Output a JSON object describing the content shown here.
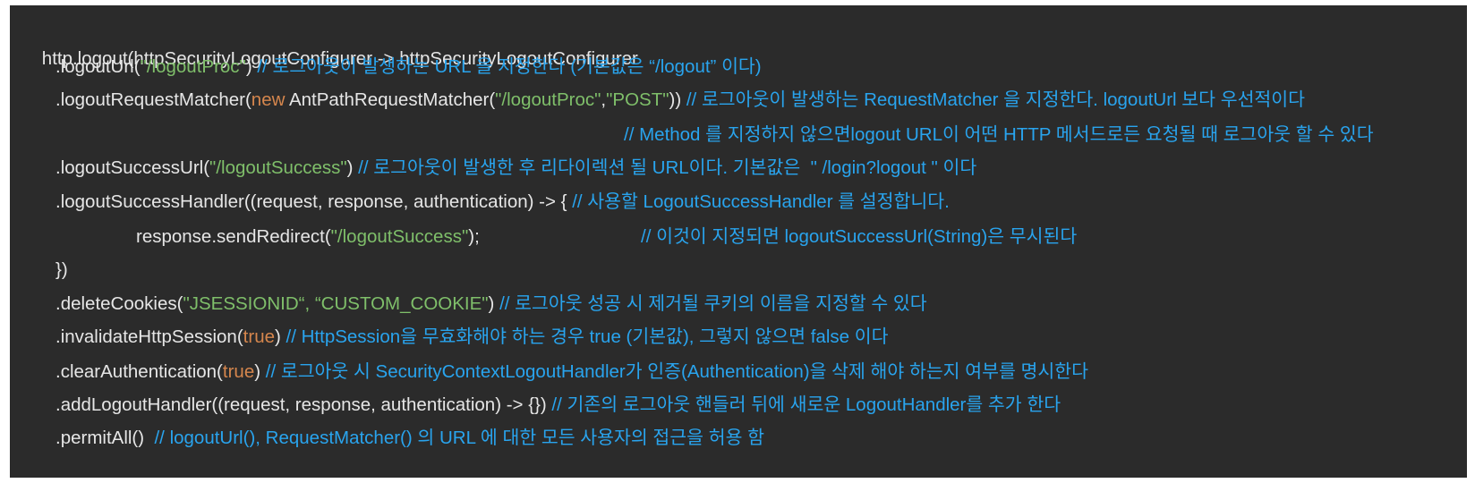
{
  "code": {
    "lines": [
      {
        "text": "http.logout(httpSecurityLogoutConfigurer -> httpSecurityLogoutConfigurer"
      },
      {
        "pre": ".logoutUrl(",
        "str": "\"/logoutProc\"",
        "post": ") ",
        "comment": "// 로그아웃이 발생하는 URL 을 지정한다 (기본값은 “/logout” 이다)"
      },
      {
        "pre": ".logoutRequestMatcher(",
        "kw": "new",
        "mid": " AntPathRequestMatcher(",
        "str1": "\"/logoutProc\"",
        "sep": ",",
        "str2": "\"POST\"",
        "post": ")) ",
        "comment": "// 로그아웃이 발생하는 RequestMatcher 을 지정한다. logoutUrl 보다 우선적이다"
      },
      {
        "comment": "// Method 를 지정하지 않으면logout URL이 어떤 HTTP 메서드로든 요청될 때 로그아웃 할 수 있다"
      },
      {
        "pre": ".logoutSuccessUrl(",
        "str": "\"/logoutSuccess\"",
        "post": ") ",
        "comment": "// 로그아웃이 발생한 후 리다이렉션 될 URL이다. 기본값은  \" /login?logout \" 이다"
      },
      {
        "pre": ".logoutSuccessHandler((request, response, authentication) -> { ",
        "comment": "// 사용할 LogoutSuccessHandler 를 설정합니다."
      },
      {
        "pre": "response.sendRedirect(",
        "str": "\"/logoutSuccess\"",
        "post": ");",
        "comment": "// 이것이 지정되면 logoutSuccessUrl(String)은 무시된다"
      },
      {
        "text": "})"
      },
      {
        "pre": ".deleteCookies(",
        "str": "\"JSESSIONID“, “CUSTOM_COOKIE\"",
        "post": ") ",
        "comment": "// 로그아웃 성공 시 제거될 쿠키의 이름을 지정할 수 있다"
      },
      {
        "pre": ".invalidateHttpSession(",
        "kw": "true",
        "post": ") ",
        "comment": "// HttpSession을 무효화해야 하는 경우 true (기본값), 그렇지 않으면 false 이다"
      },
      {
        "pre": ".clearAuthentication(",
        "kw": "true",
        "post": ") ",
        "comment": "// 로그아웃 시 SecurityContextLogoutHandler가 인증(Authentication)을 삭제 해야 하는지 여부를 명시한다"
      },
      {
        "pre": ".addLogoutHandler((request, response, authentication) -> {}) ",
        "comment": "// 기존의 로그아웃 핸들러 뒤에 새로운 LogoutHandler를 추가 한다"
      },
      {
        "pre": ".permitAll()  ",
        "comment": "// logoutUrl(), RequestMatcher() 의 URL 에 대한 모든 사용자의 접근을 허용 함"
      }
    ]
  },
  "colors": {
    "background": "#2b2b2b",
    "text": "#e6e6e6",
    "string": "#7fbf6a",
    "keyword": "#d5864d",
    "comment": "#29a4ee"
  }
}
